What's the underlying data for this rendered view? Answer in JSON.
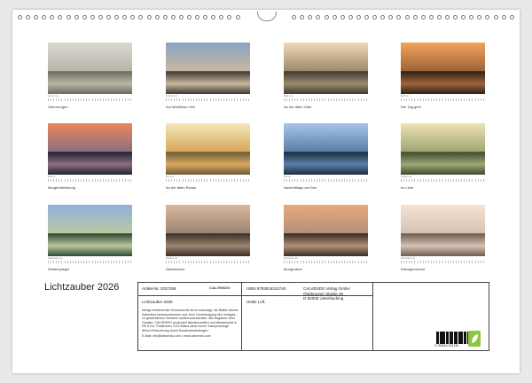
{
  "calendar_title": "Lichtzauber 2026",
  "photos": [
    {
      "caption": "Odermorgen",
      "date": "Januar xxx",
      "colors": [
        "#d9d8d2",
        "#b9b6a8",
        "#6b6a5c"
      ]
    },
    {
      "caption": "Am Mühlbrser See",
      "date": "Februar xxx",
      "colors": [
        "#8aa3c4",
        "#c8b7a0",
        "#3b3a34"
      ]
    },
    {
      "caption": "An der alten Oder",
      "date": "März xxx",
      "colors": [
        "#f0d9b9",
        "#9c8b6c",
        "#3d3a30"
      ]
    },
    {
      "caption": "Der Tag geht",
      "date": "April xxx",
      "colors": [
        "#f2a45a",
        "#a0633a",
        "#2c2218"
      ]
    },
    {
      "caption": "Morgenstimmung",
      "date": "Mai xxx",
      "colors": [
        "#e7875d",
        "#8d6f7e",
        "#1f2330"
      ]
    },
    {
      "caption": "An der alten Reuse",
      "date": "Juni xxx",
      "colors": [
        "#f4e7b8",
        "#d9a85c",
        "#6e5b3a"
      ]
    },
    {
      "caption": "Nachmittags am See",
      "date": "Juli xxx",
      "colors": [
        "#a7c5e8",
        "#5b7fa8",
        "#1c2c3c"
      ]
    },
    {
      "caption": "Im Licht",
      "date": "August xxx",
      "colors": [
        "#efe2b2",
        "#9fa774",
        "#3e4a2d"
      ]
    },
    {
      "caption": "Winterspiegel",
      "date": "September xxx",
      "colors": [
        "#8fb1dc",
        "#bcc7a0",
        "#2f4a32"
      ]
    },
    {
      "caption": "Nebelsonne",
      "date": "Oktober xxx",
      "colors": [
        "#d9b9a0",
        "#9c8470",
        "#3b2f28"
      ]
    },
    {
      "caption": "Morgenlicht",
      "date": "November xxx",
      "colors": [
        "#e9a97b",
        "#b2907b",
        "#3a2c22"
      ]
    },
    {
      "caption": "Eisbogenszene",
      "date": "Dezember xxx",
      "colors": [
        "#f5e3d4",
        "#d6c2b4",
        "#6e5d50"
      ]
    }
  ],
  "info_box": {
    "article_no": "Artikel-Nr. 2037269",
    "isbn": "ISBN 9783516224740",
    "publisher_line1": "CALVENDO Verlag GmbH",
    "publisher_line2": "Ottobrunner Straße 39",
    "publisher_line3": "D-82008 Unterhaching",
    "logo_text": "CALVENDO",
    "product_title": "Lichtzauber 2026",
    "author": "Heike Loß",
    "fine_print": "Infolge bestehender Schutzrechte ist es untersagt, die Blätter dieses Kalenders herauszutrennen und ohne Genehmigung des Verlages zu gewerblichen Zwecken weiterzuverwenden. Alle Angaben ohne Gewähr. CALVENDO produziert klimafreundlich und klimaneutral in DE & EU. Positiveres CO2-Bilanz dank kurzer Transportwege. Abhol-Reduzierung durch Kundenbestellungen.",
    "contact": "E-Mail: info@calvendo.com • www.calvendo.com",
    "barcode_number": "9 783516 224740"
  }
}
